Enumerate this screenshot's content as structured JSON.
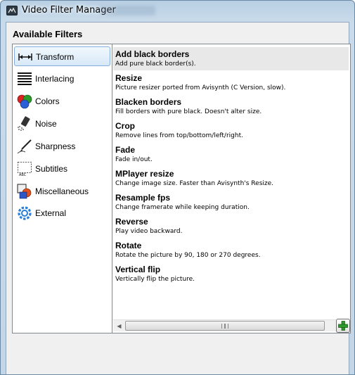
{
  "window": {
    "title": "Video Filter Manager"
  },
  "section_title": "Available Filters",
  "categories": [
    {
      "label": "Transform",
      "icon": "transform-icon",
      "selected": true
    },
    {
      "label": "Interlacing",
      "icon": "interlacing-icon",
      "selected": false
    },
    {
      "label": "Colors",
      "icon": "colors-icon",
      "selected": false
    },
    {
      "label": "Noise",
      "icon": "noise-icon",
      "selected": false
    },
    {
      "label": "Sharpness",
      "icon": "sharpness-icon",
      "selected": false
    },
    {
      "label": "Subtitles",
      "icon": "subtitles-icon",
      "selected": false
    },
    {
      "label": "Miscellaneous",
      "icon": "miscellaneous-icon",
      "selected": false
    },
    {
      "label": "External",
      "icon": "external-icon",
      "selected": false
    }
  ],
  "filters": [
    {
      "name": "Add black borders",
      "desc": "Add pure black border(s).",
      "selected": true
    },
    {
      "name": "Resize",
      "desc": "Picture resizer ported from Avisynth (C Version, slow).",
      "selected": false
    },
    {
      "name": "Blacken borders",
      "desc": "Fill borders with pure black. Doesn't alter size.",
      "selected": false
    },
    {
      "name": "Crop",
      "desc": "Remove lines from top/bottom/left/right.",
      "selected": false
    },
    {
      "name": "Fade",
      "desc": "Fade in/out.",
      "selected": false
    },
    {
      "name": "MPlayer resize",
      "desc": "Change image size. Faster than Avisynth's Resize.",
      "selected": false
    },
    {
      "name": "Resample fps",
      "desc": "Change framerate while keeping duration.",
      "selected": false
    },
    {
      "name": "Reverse",
      "desc": "Play video backward.",
      "selected": false
    },
    {
      "name": "Rotate",
      "desc": "Rotate the picture by 90, 180 or 270 degrees.",
      "selected": false
    },
    {
      "name": "Vertical flip",
      "desc": "Vertically flip the picture.",
      "selected": false
    }
  ],
  "colors": {
    "selection_border": "#84acdd",
    "add_icon_green": "#2e9a2e"
  }
}
